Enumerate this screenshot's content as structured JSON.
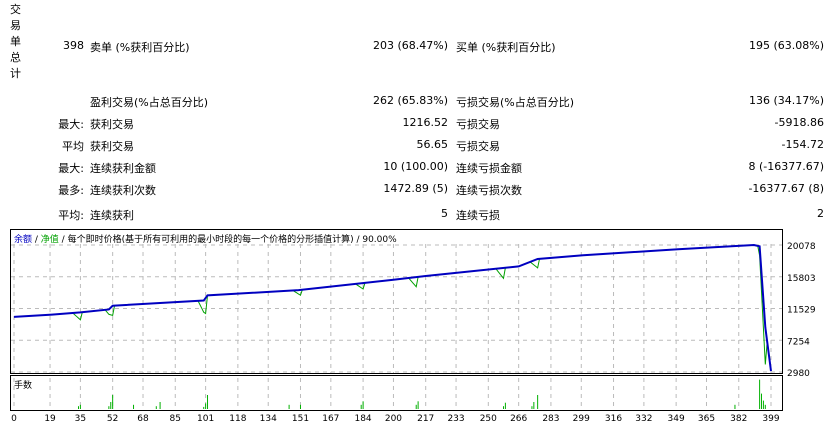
{
  "stats": {
    "section_label": "交易单总计",
    "total": "398",
    "rows": [
      {
        "prefix": "",
        "l_label": "卖单 (%获利百分比)",
        "l_value": "203 (68.47%)",
        "r_label": "买单 (%获利百分比)",
        "r_value": "195 (63.08%)"
      },
      {
        "prefix": "",
        "l_label": "盈利交易(%占总百分比)",
        "l_value": "262 (65.83%)",
        "r_label": "亏损交易(%占总百分比)",
        "r_value": "136 (34.17%)"
      },
      {
        "prefix": "最大:",
        "l_label": "获利交易",
        "l_value": "1216.52",
        "r_label": "亏损交易",
        "r_value": "-5918.86"
      },
      {
        "prefix": "平均",
        "l_label": "获利交易",
        "l_value": "56.65",
        "r_label": "亏损交易",
        "r_value": "-154.72"
      },
      {
        "prefix": "最大:",
        "l_label": "连续获利金额",
        "l_value": "10 (100.00)",
        "r_label": "连续亏损金额",
        "r_value": "8 (-16377.67)"
      },
      {
        "prefix": "最多:",
        "l_label": "连续获利次数",
        "l_value": "1472.89 (5)",
        "r_label": "连续亏损次数",
        "r_value": "-16377.67 (8)"
      },
      {
        "prefix": "平均:",
        "l_label": "连续获利",
        "l_value": "5",
        "r_label": "连续亏损",
        "r_value": "2"
      }
    ]
  },
  "chart": {
    "legend_balance": "余额",
    "sep1": " / ",
    "legend_equity": "净值",
    "sep2": " / ",
    "legend_desc": "每个即时价格(基于所有可利用的最小时段的每一个价格的分形插值计算)",
    "sep3": " / ",
    "legend_quality": "90.00%",
    "volume_label": "手数",
    "colors": {
      "balance": "#0000c0",
      "equity": "#00a000",
      "volume": "#00b000"
    }
  },
  "chart_data": {
    "type": "line",
    "xlim": [
      0,
      399
    ],
    "ylim": [
      2980,
      20078
    ],
    "y_ticks": [
      "20078",
      "15803",
      "11529",
      "7254",
      "2980"
    ],
    "x_ticks": [
      "0",
      "19",
      "35",
      "52",
      "68",
      "85",
      "101",
      "118",
      "134",
      "151",
      "167",
      "184",
      "200",
      "217",
      "233",
      "250",
      "266",
      "283",
      "299",
      "316",
      "332",
      "349",
      "365",
      "382",
      "399"
    ],
    "balance": [
      [
        0,
        10400
      ],
      [
        20,
        10700
      ],
      [
        35,
        11000
      ],
      [
        50,
        11400
      ],
      [
        52,
        11900
      ],
      [
        100,
        12600
      ],
      [
        102,
        13300
      ],
      [
        150,
        14000
      ],
      [
        200,
        15400
      ],
      [
        217,
        15900
      ],
      [
        266,
        17200
      ],
      [
        276,
        18200
      ],
      [
        300,
        18700
      ],
      [
        350,
        19500
      ],
      [
        390,
        20078
      ],
      [
        393,
        19900
      ],
      [
        396,
        9000
      ],
      [
        399,
        3100
      ]
    ],
    "equity_dips": [
      [
        35,
        1000
      ],
      [
        52,
        1300
      ],
      [
        101,
        2100
      ],
      [
        151,
        700
      ],
      [
        184,
        800
      ],
      [
        212,
        1300
      ],
      [
        258,
        1400
      ],
      [
        276,
        1200
      ],
      [
        396,
        5000
      ]
    ],
    "volumes": [
      [
        34,
        0.2
      ],
      [
        35,
        0.3
      ],
      [
        50,
        0.2
      ],
      [
        51,
        0.5
      ],
      [
        52,
        1
      ],
      [
        63,
        0.3
      ],
      [
        75,
        0.2
      ],
      [
        77,
        0.5
      ],
      [
        100,
        0.15
      ],
      [
        101,
        0.4
      ],
      [
        102,
        1
      ],
      [
        145,
        0.3
      ],
      [
        151,
        0.3
      ],
      [
        183,
        0.3
      ],
      [
        184,
        0.55
      ],
      [
        212,
        0.3
      ],
      [
        213,
        0.55
      ],
      [
        258,
        0.2
      ],
      [
        259,
        0.45
      ],
      [
        273,
        0.2
      ],
      [
        274,
        0.5
      ],
      [
        276,
        1
      ],
      [
        380,
        0.3
      ],
      [
        393,
        2.1
      ],
      [
        394,
        1.1
      ],
      [
        395,
        0.6
      ],
      [
        396,
        0.3
      ]
    ]
  }
}
